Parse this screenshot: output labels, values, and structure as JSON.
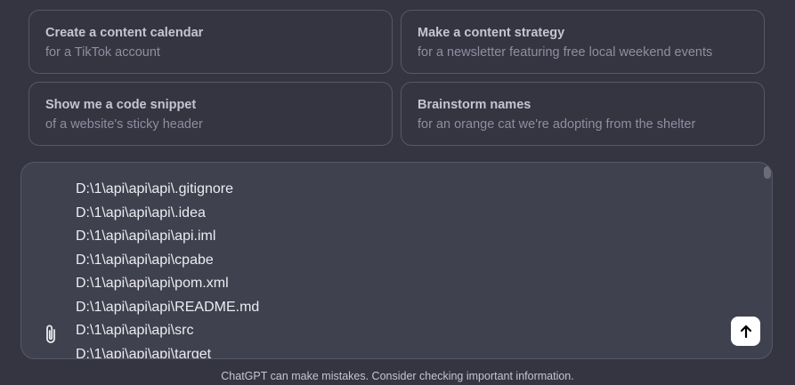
{
  "suggestions": [
    {
      "title": "Create a content calendar",
      "subtitle": "for a TikTok account"
    },
    {
      "title": "Make a content strategy",
      "subtitle": "for a newsletter featuring free local weekend events"
    },
    {
      "title": "Show me a code snippet",
      "subtitle": "of a website's sticky header"
    },
    {
      "title": "Brainstorm names",
      "subtitle": "for an orange cat we're adopting from the shelter"
    }
  ],
  "composer": {
    "lines": [
      "D:\\1\\api\\api\\api\\.gitignore",
      "D:\\1\\api\\api\\api\\.idea",
      "D:\\1\\api\\api\\api\\api.iml",
      "D:\\1\\api\\api\\api\\cpabe",
      "D:\\1\\api\\api\\api\\pom.xml",
      "D:\\1\\api\\api\\api\\README.md",
      "D:\\1\\api\\api\\api\\src",
      "D:\\1\\api\\api\\api\\target"
    ],
    "attach_icon": "paperclip-icon",
    "send_icon": "arrow-up-icon"
  },
  "footer": {
    "disclaimer": "ChatGPT can make mistakes. Consider checking important information."
  },
  "colors": {
    "background": "#343541",
    "composer_bg": "#40414f",
    "border": "#565869",
    "send_button": "#ffffff"
  }
}
